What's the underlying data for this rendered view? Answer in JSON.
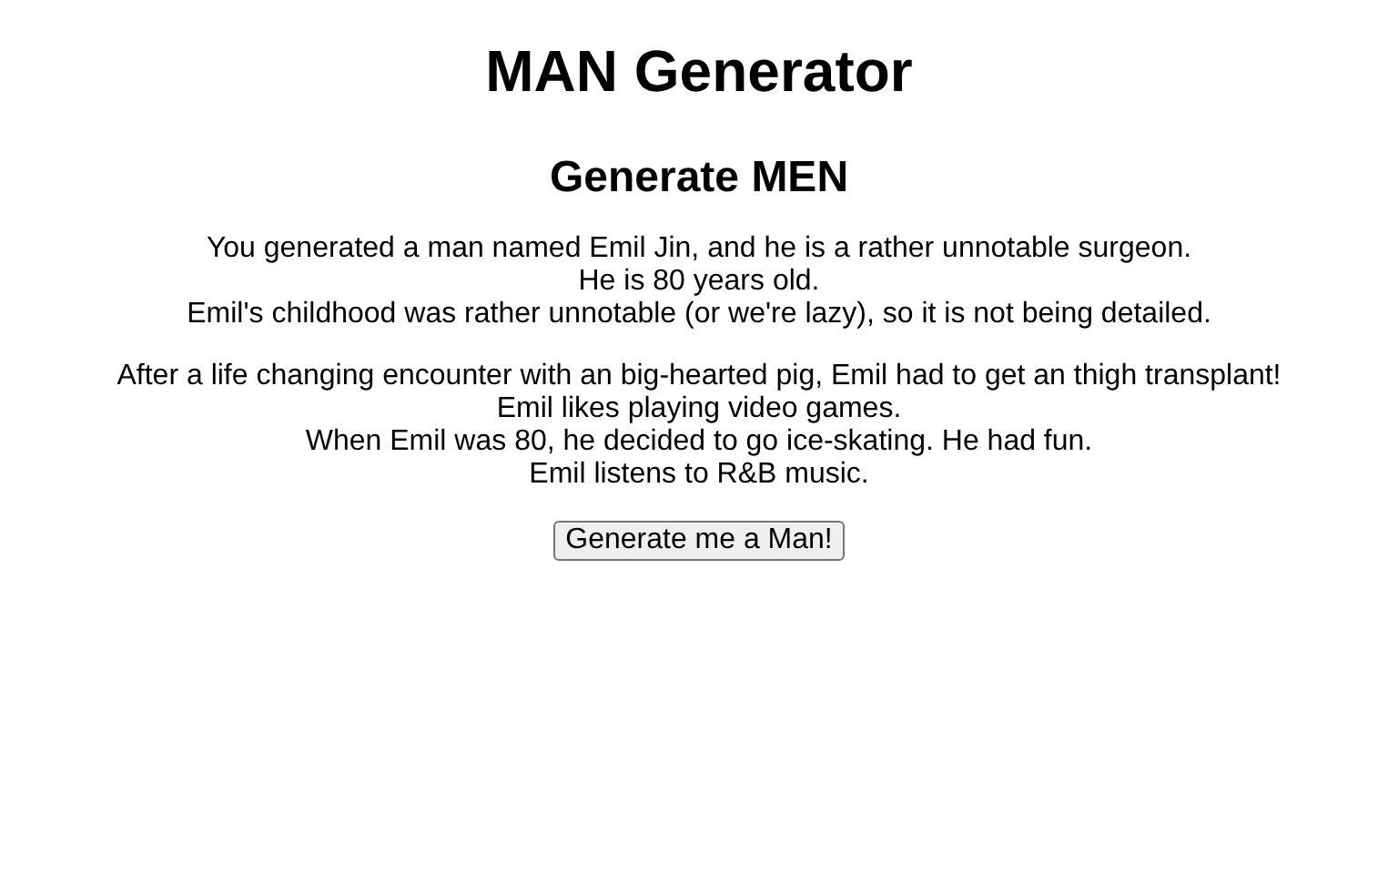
{
  "title": "MAN Generator",
  "subtitle": "Generate MEN",
  "paragraphs": [
    [
      "You generated a man named Emil Jin, and he is a rather unnotable surgeon.",
      "He is 80 years old.",
      "Emil's childhood was rather unnotable (or we're lazy), so it is not being detailed."
    ],
    [
      "After a life changing encounter with an big-hearted pig, Emil had to get an thigh transplant!",
      "Emil likes playing video games.",
      "When Emil was 80, he decided to go ice-skating. He had fun.",
      "Emil listens to R&B music."
    ]
  ],
  "button": "Generate me a Man!"
}
